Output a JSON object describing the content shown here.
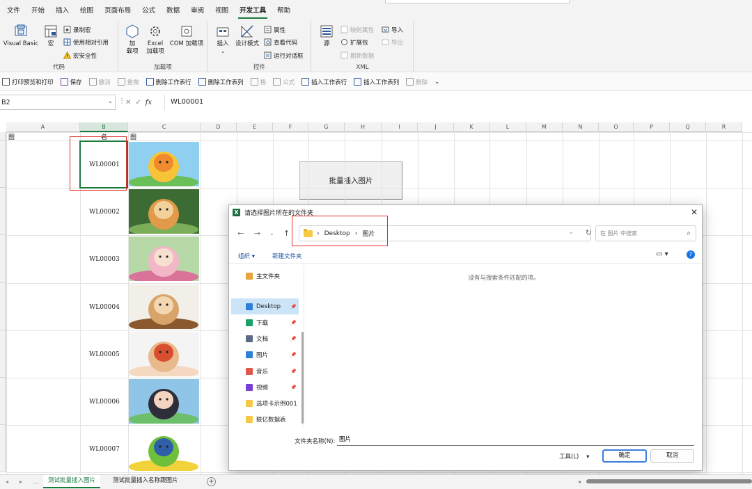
{
  "menu": [
    "文件",
    "开始",
    "插入",
    "绘图",
    "页面布局",
    "公式",
    "数据",
    "审阅",
    "视图",
    "开发工具",
    "帮助"
  ],
  "menu_active": "开发工具",
  "ribbon": {
    "code": {
      "label": "代码",
      "visual_basic": "Visual Basic",
      "macros": "宏",
      "record_macro": "录制宏",
      "relative_ref": "使用相对引用",
      "macro_security": "宏安全性"
    },
    "addins": {
      "label": "加载项",
      "addins_line1": "加",
      "addins_line2": "载项",
      "excel_addins_line1": "Excel",
      "excel_addins_line2": "加载项",
      "com_addins": "COM 加载项"
    },
    "controls": {
      "label": "控件",
      "insert": "插入",
      "design_mode": "设计模式",
      "properties": "属性",
      "view_code": "查看代码",
      "run_dialog": "运行对话框"
    },
    "xml": {
      "label": "XML",
      "source": "源",
      "map_props": "映射属性",
      "expansion": "扩展包",
      "refresh": "刷新数据",
      "import": "导入",
      "export": "导出"
    }
  },
  "quick_toolbar": [
    {
      "label": "打印预览和打印",
      "enabled": true
    },
    {
      "label": "保存",
      "enabled": true
    },
    {
      "label": "撤消",
      "enabled": false
    },
    {
      "label": "重做",
      "enabled": false
    },
    {
      "label": "删除工作表行",
      "enabled": true
    },
    {
      "label": "删除工作表列",
      "enabled": true
    },
    {
      "label": "格",
      "enabled": false
    },
    {
      "label": "公式",
      "enabled": false
    },
    {
      "label": "插入工作表行",
      "enabled": true
    },
    {
      "label": "插入工作表列",
      "enabled": true
    },
    {
      "label": "删除",
      "enabled": false
    }
  ],
  "formula_bar": {
    "name_box": "B2",
    "fx": "fx",
    "value": "WL00001"
  },
  "columns": [
    "A",
    "B",
    "C",
    "D",
    "E",
    "F",
    "G",
    "H",
    "I",
    "J",
    "K",
    "L",
    "M",
    "N",
    "O",
    "P",
    "Q",
    "R"
  ],
  "header_row": {
    "a": "图",
    "b": "名",
    "c": "图"
  },
  "names": [
    "WL00001",
    "WL00002",
    "WL00003",
    "WL00004",
    "WL00005",
    "WL00006",
    "WL00007"
  ],
  "macro_button": "批量插入图片",
  "dialog": {
    "title": "请选择图片所在的文件夹",
    "path": [
      "Desktop",
      "图片"
    ],
    "search_placeholder": "在 图片 中搜索",
    "organize": "组织 ▾",
    "new_folder": "新建文件夹",
    "nav_items": [
      {
        "label": "主文件夹",
        "icon": "home-icon",
        "pinned": false
      },
      {
        "label": "Desktop",
        "icon": "desktop-icon",
        "pinned": true
      },
      {
        "label": "下载",
        "icon": "download-icon",
        "pinned": true
      },
      {
        "label": "文档",
        "icon": "document-icon",
        "pinned": true
      },
      {
        "label": "图片",
        "icon": "pictures-icon",
        "pinned": true
      },
      {
        "label": "音乐",
        "icon": "music-icon",
        "pinned": true
      },
      {
        "label": "视频",
        "icon": "video-icon",
        "pinned": true
      },
      {
        "label": "选项卡示例001",
        "icon": "folder-icon",
        "pinned": false
      },
      {
        "label": "联亿数据表",
        "icon": "folder-icon",
        "pinned": false
      }
    ],
    "selected_nav": "Desktop",
    "empty_text": "没有与搜索条件匹配的项。",
    "folder_name_label": "文件夹名称(N):",
    "folder_name_value": "图片",
    "tools": "工具(L)",
    "ok": "确定",
    "cancel": "取消"
  },
  "sheet_tabs": [
    "测试批量插入图片",
    "测试批量插入名称跟图片"
  ],
  "active_sheet": "测试批量插入图片",
  "colors": {
    "excel_green": "#1a7a3e",
    "highlight_red": "#e0302c",
    "selection_blue": "#cce4f7"
  }
}
